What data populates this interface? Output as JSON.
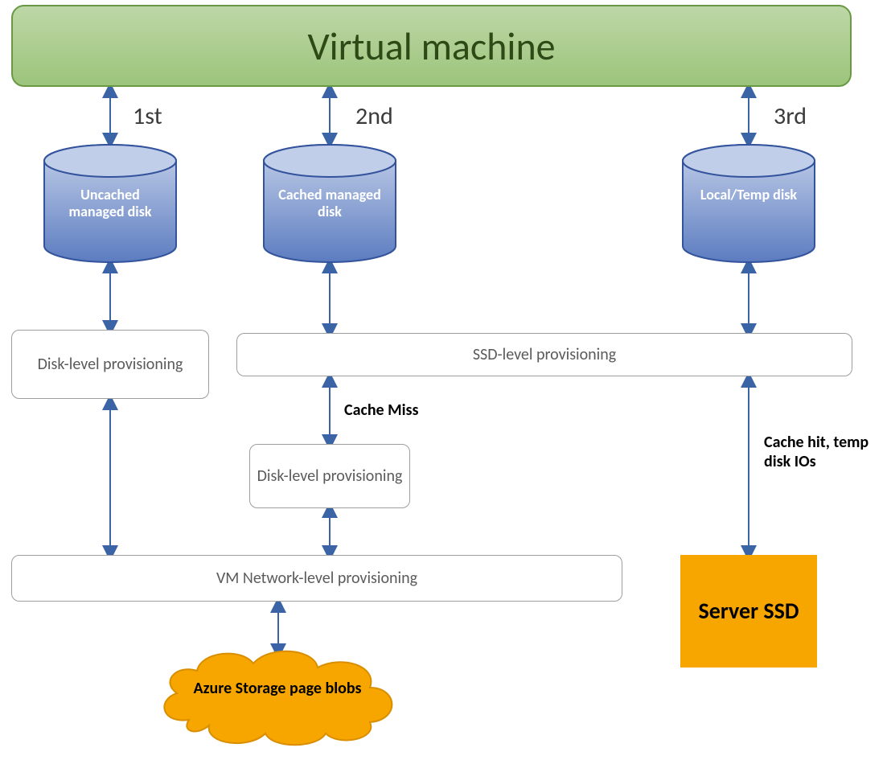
{
  "title": "Virtual machine",
  "ordinals": {
    "first": "1st",
    "second": "2nd",
    "third": "3rd"
  },
  "disks": {
    "uncached": "Uncached managed disk",
    "cached": "Cached managed disk",
    "local": "Local/Temp disk"
  },
  "provisioning": {
    "disk_level": "Disk-level provisioning",
    "ssd_level": "SSD-level provisioning",
    "disk_level_2": "Disk-level provisioning",
    "network_level": "VM Network-level provisioning"
  },
  "labels": {
    "cache_miss": "Cache Miss",
    "cache_hit": "Cache hit, temp disk IOs"
  },
  "cloud": "Azure Storage page blobs",
  "ssd": "Server SSD",
  "colors": {
    "arrow": "#3a64a6",
    "cylinder_top": "#b6c5e4",
    "cylinder_bottom": "#5c7cc0",
    "cylinder_stroke": "#33539c",
    "gold": "#f7a600",
    "gold_stroke": "#d98e00"
  }
}
